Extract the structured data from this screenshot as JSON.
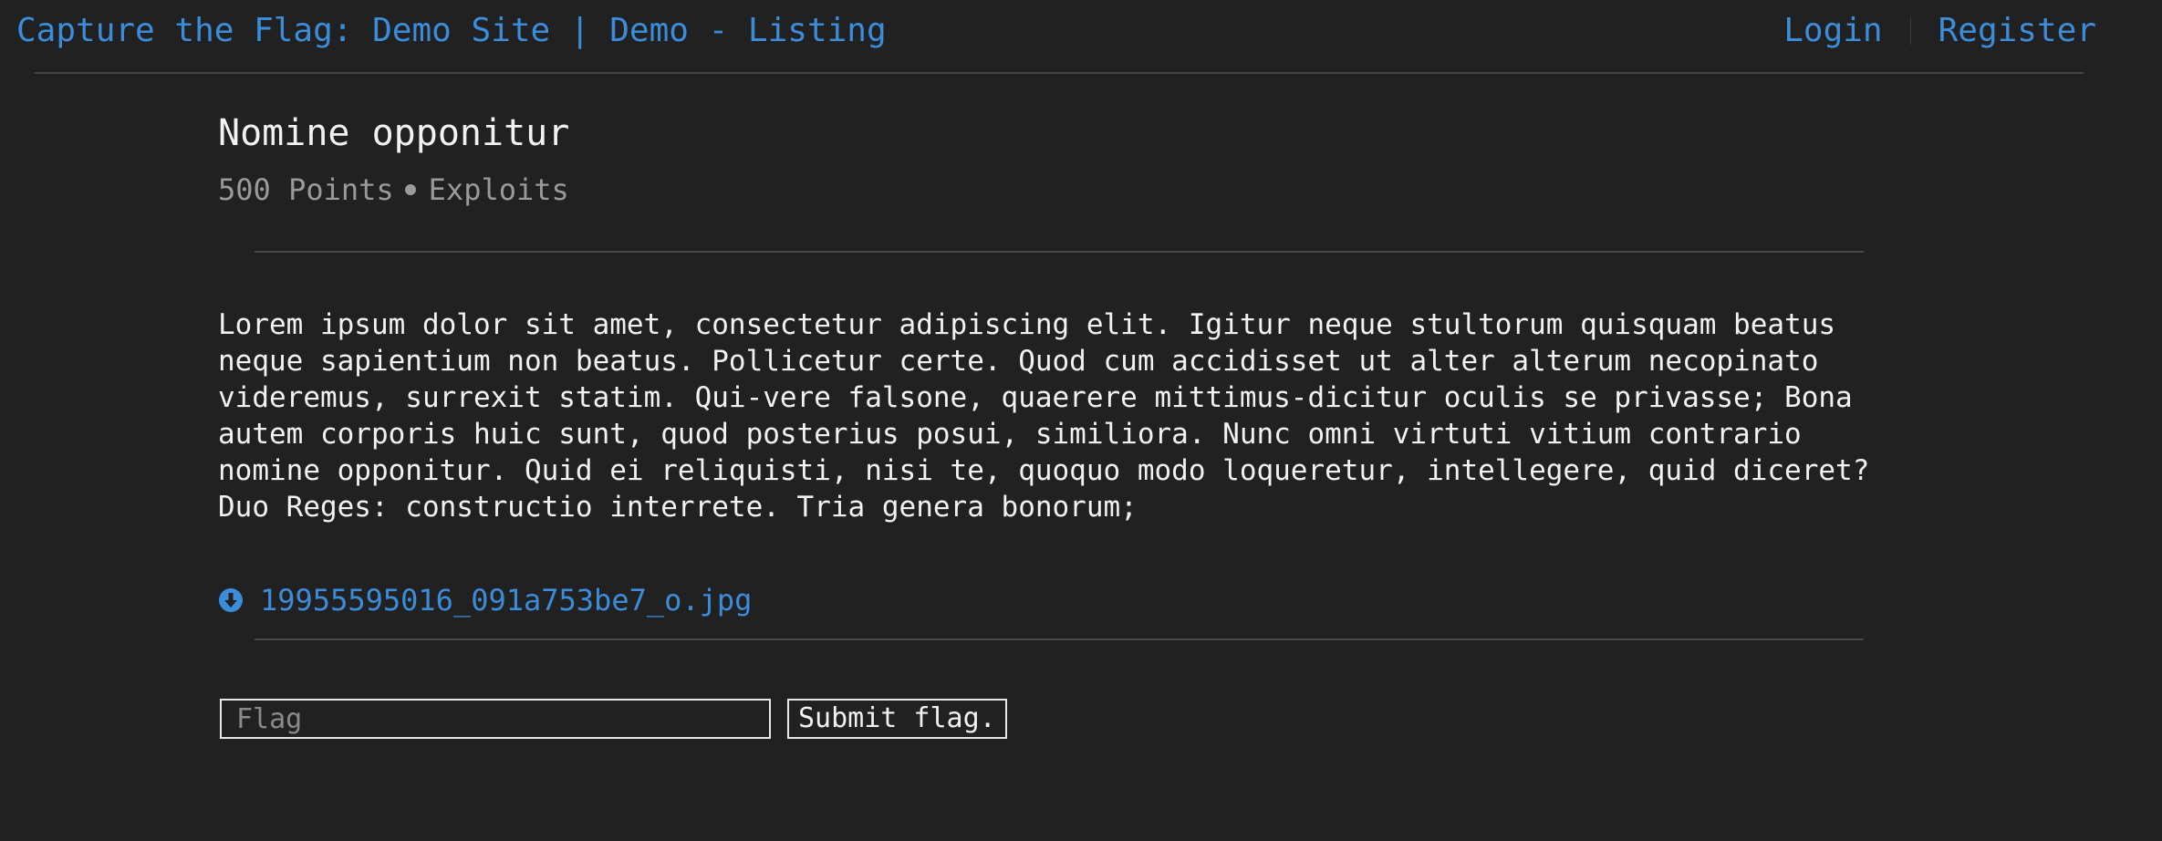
{
  "header": {
    "site_title": "Capture the Flag: Demo Site | Demo - Listing",
    "login_label": "Login",
    "register_label": "Register"
  },
  "challenge": {
    "title": "Nomine opponitur",
    "points": "500 Points",
    "category": "Exploits",
    "description": "Lorem ipsum dolor sit amet, consectetur adipiscing elit. Igitur neque stultorum quisquam beatus neque sapientium non beatus. Pollicetur certe. Quod cum accidisset ut alter alterum necopinato videremus, surrexit statim. Qui-vere falsone, quaerere mittimus-dicitur oculis se privasse; Bona autem corporis huic sunt, quod posterius posui, similiora. Nunc omni virtuti vitium contrario nomine opponitur. Quid ei reliquisti, nisi te, quoquo modo loqueretur, intellegere, quid diceret? Duo Reges: constructio interrete. Tria genera bonorum;",
    "attachment": {
      "icon": "download-icon",
      "filename": "19955595016_091a753be7_o.jpg"
    }
  },
  "flag_form": {
    "placeholder": "Flag",
    "value": "",
    "submit_label": "Submit flag."
  },
  "colors": {
    "background": "#212121",
    "link": "#3b8ddb",
    "text": "#f2f2f2",
    "muted": "#9a9a9a"
  }
}
